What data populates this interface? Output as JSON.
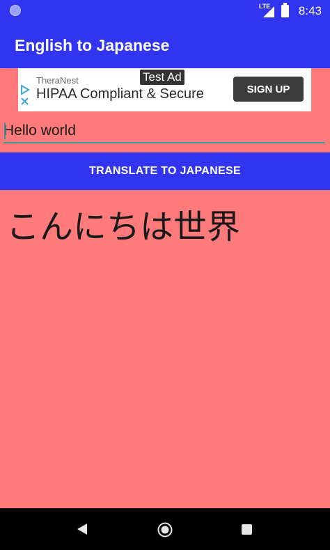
{
  "status_bar": {
    "network_label": "LTE",
    "time": "8:43",
    "icons": [
      "notification-dot-icon",
      "lte-signal-icon",
      "battery-icon"
    ]
  },
  "app_bar": {
    "title": "English to Japanese"
  },
  "ad": {
    "tag": "Test Ad",
    "company": "TheraNest",
    "headline": "HIPAA Compliant & Secure",
    "cta_label": "SIGN UP"
  },
  "input": {
    "value": "Hello world"
  },
  "actions": {
    "translate_label": "TRANSLATE TO JAPANESE"
  },
  "output": {
    "text": "こんにちは世界"
  },
  "nav": {
    "icons": [
      "back-icon",
      "home-icon",
      "recents-icon"
    ]
  },
  "colors": {
    "primary": "#3135f0",
    "background": "#ff7b7b",
    "accent": "#2e9f9a",
    "nav_bar": "#000000"
  }
}
